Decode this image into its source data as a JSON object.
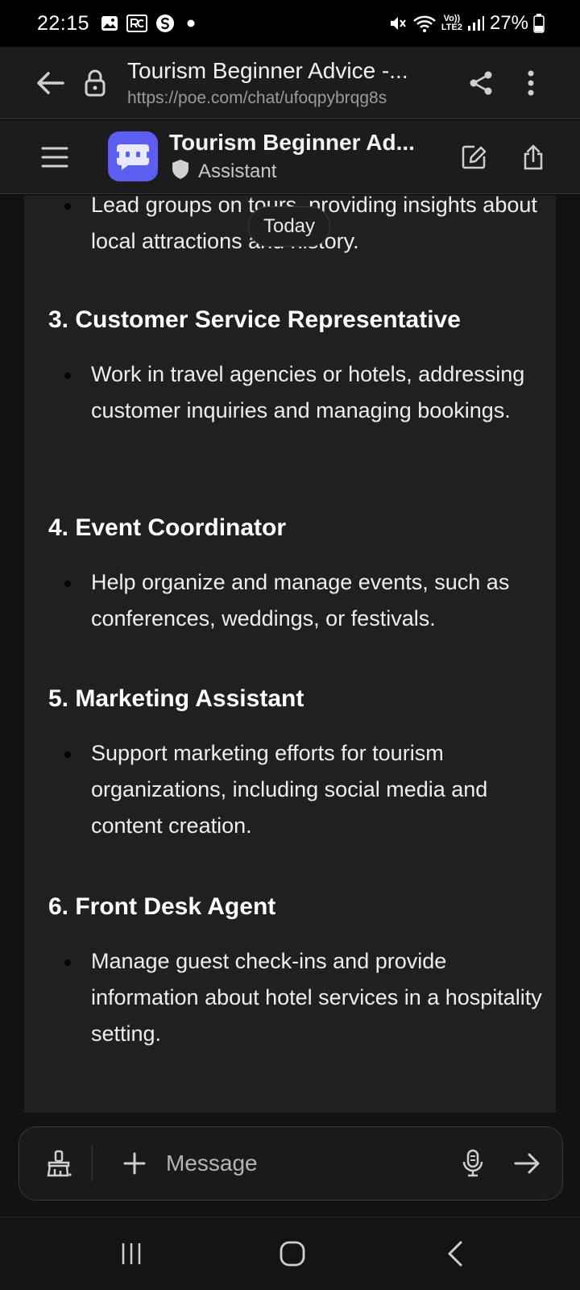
{
  "status_bar": {
    "time": "22:15",
    "left_icons": [
      "gallery-icon",
      "rc-icon",
      "s-icon",
      "dot-icon"
    ],
    "network_label_top": "Vo))",
    "network_label_bottom": "LTE2",
    "battery": "27%"
  },
  "browser": {
    "tab_title": "Tourism Beginner Advice -...",
    "url": "https://poe.com/chat/ufoqpybrqg8s"
  },
  "chat_header": {
    "bot_name": "Tourism Beginner Ad...",
    "bot_role": "Assistant"
  },
  "date_pill": "Today",
  "message": {
    "intro_bullet": "Lead groups on tours, providing insights about local attractions and history.",
    "sections": [
      {
        "heading": "3. Customer Service Representative",
        "bullet": "Work in travel agencies or hotels, addressing customer inquiries and managing bookings."
      },
      {
        "heading": "4. Event Coordinator",
        "bullet": "Help organize and manage events, such as conferences, weddings, or festivals."
      },
      {
        "heading": "5. Marketing Assistant",
        "bullet": "Support marketing efforts for tourism organizations, including social media and content creation."
      },
      {
        "heading": "6. Front Desk Agent",
        "bullet": "Manage guest check-ins and provide information about hotel services in a hospitality setting."
      }
    ]
  },
  "composer": {
    "placeholder": "Message"
  },
  "colors": {
    "bot_avatar": "#5b5ef0",
    "card_background": "#202022",
    "chat_background": "#121212",
    "header_background": "#1c1c1e"
  }
}
